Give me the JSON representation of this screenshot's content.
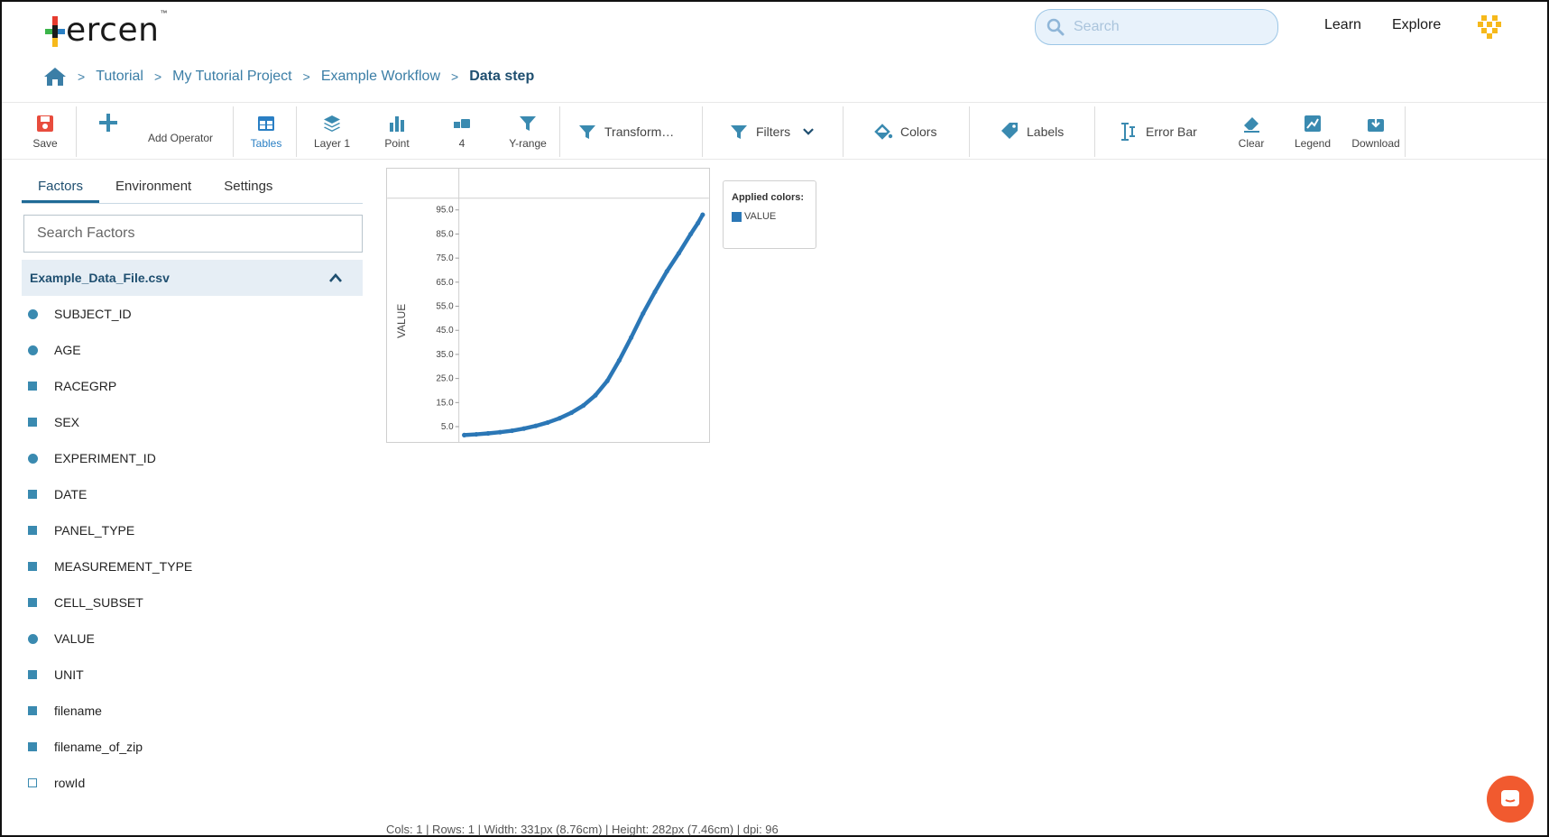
{
  "header": {
    "logo_text": "ercen",
    "logo_tm": "™",
    "search_placeholder": "Search",
    "links": [
      "Learn",
      "Explore"
    ]
  },
  "breadcrumb": {
    "home_icon": "home-icon",
    "separator": ">",
    "items": [
      "Tutorial",
      "My Tutorial Project",
      "Example Workflow"
    ],
    "current": "Data step"
  },
  "toolbar": {
    "save": "Save",
    "add_operator": "Add Operator",
    "tables": "Tables",
    "layer": "Layer 1",
    "point": "Point",
    "count": "4",
    "yrange": "Y-range",
    "transform": "Transform…",
    "filters": "Filters",
    "colors": "Colors",
    "labels": "Labels",
    "error_bar": "Error Bar",
    "clear": "Clear",
    "legend": "Legend",
    "download": "Download"
  },
  "left_panel": {
    "tabs": [
      "Factors",
      "Environment",
      "Settings"
    ],
    "active_tab": "Factors",
    "search_placeholder": "Search Factors",
    "file_name": "Example_Data_File.csv",
    "factors": [
      {
        "name": "SUBJECT_ID",
        "marker": "circle"
      },
      {
        "name": "AGE",
        "marker": "circle"
      },
      {
        "name": "RACEGRP",
        "marker": "square"
      },
      {
        "name": "SEX",
        "marker": "square"
      },
      {
        "name": "EXPERIMENT_ID",
        "marker": "circle"
      },
      {
        "name": "DATE",
        "marker": "square"
      },
      {
        "name": "PANEL_TYPE",
        "marker": "square"
      },
      {
        "name": "MEASUREMENT_TYPE",
        "marker": "square"
      },
      {
        "name": "CELL_SUBSET",
        "marker": "square"
      },
      {
        "name": "VALUE",
        "marker": "circle"
      },
      {
        "name": "UNIT",
        "marker": "square"
      },
      {
        "name": "filename",
        "marker": "square"
      },
      {
        "name": "filename_of_zip",
        "marker": "square"
      },
      {
        "name": "rowId",
        "marker": "empty"
      }
    ]
  },
  "legend": {
    "title": "Applied colors:",
    "items": [
      {
        "label": "VALUE",
        "color": "#2b77b6"
      }
    ]
  },
  "status_bar": "Cols: 1 | Rows: 1 | Width: 331px (8.76cm) | Height: 282px (7.46cm) | dpi: 96",
  "colors": {
    "accent": "#2a7fc4",
    "series": "#2b77b6",
    "chat_button": "#f15a2f"
  },
  "chart_data": {
    "type": "scatter",
    "title": "",
    "xlabel": "",
    "ylabel": "VALUE",
    "ylim": [
      0.5,
      98
    ],
    "yticks": [
      5.0,
      15.0,
      25.0,
      35.0,
      45.0,
      55.0,
      65.0,
      75.0,
      85.0,
      95.0
    ],
    "ytick_labels": [
      "5.0",
      "15.0",
      "25.0",
      "35.0",
      "45.0",
      "55.0",
      "65.0",
      "75.0",
      "85.0",
      "95.0"
    ],
    "grid": false,
    "series": [
      {
        "name": "VALUE",
        "color": "#2b77b6",
        "x": [
          0,
          0.05,
          0.1,
          0.15,
          0.2,
          0.25,
          0.3,
          0.35,
          0.4,
          0.45,
          0.5,
          0.55,
          0.6,
          0.65,
          0.7,
          0.75,
          0.8,
          0.85,
          0.9,
          0.95,
          0.98,
          1.0
        ],
        "values": [
          1.5,
          1.8,
          2.2,
          2.7,
          3.3,
          4.2,
          5.3,
          6.7,
          8.5,
          10.8,
          13.8,
          18.0,
          24.0,
          32.5,
          42.0,
          52.0,
          61.0,
          69.5,
          77.0,
          85.0,
          89.5,
          93.0
        ]
      }
    ]
  }
}
